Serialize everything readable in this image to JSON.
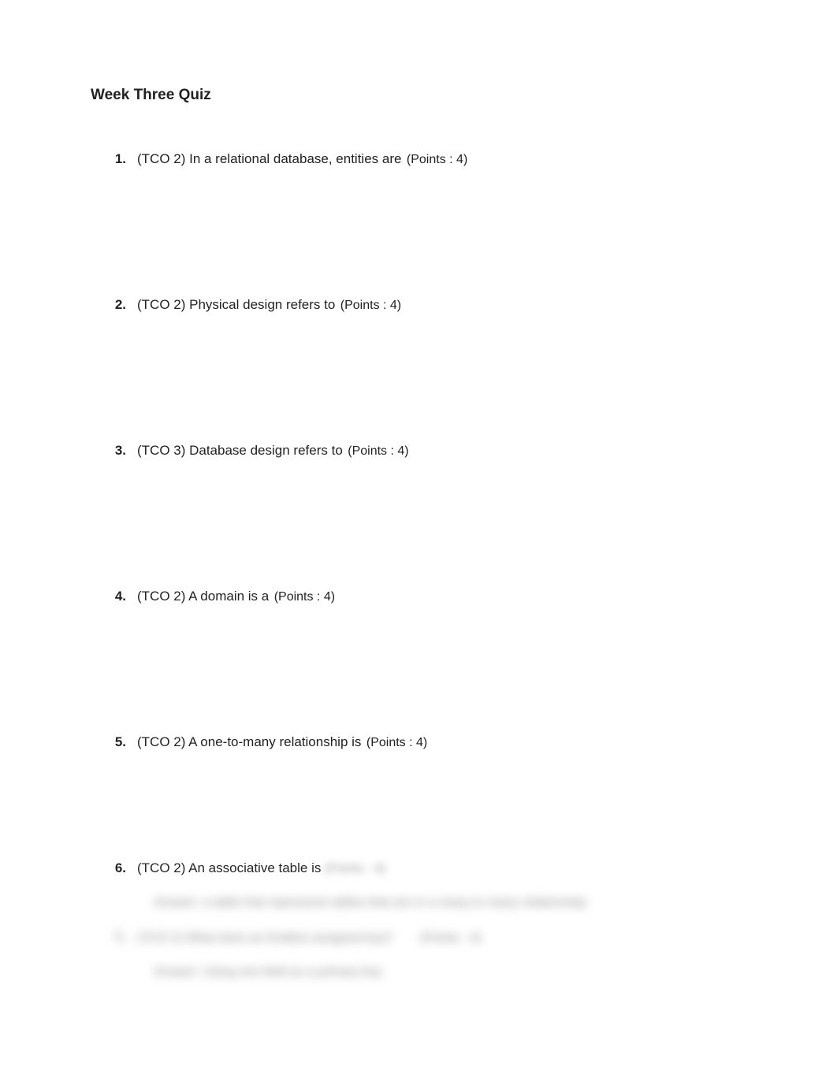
{
  "title": "Week Three Quiz",
  "questions": [
    {
      "number": "1.",
      "text": "(TCO 2) In a relational database, entities are",
      "points": "(Points : 4)"
    },
    {
      "number": "2.",
      "text": "(TCO 2) Physical design refers to",
      "points": "(Points : 4)"
    },
    {
      "number": "3.",
      "text": "(TCO 3) Database design refers to",
      "points": "(Points : 4)"
    },
    {
      "number": "4.",
      "text": "(TCO 2) A domain is a",
      "points": "(Points : 4)"
    },
    {
      "number": "5.",
      "text": "(TCO 2) A one-to-many relationship is",
      "points": "(Points : 4)"
    }
  ],
  "q6": {
    "number": "6.",
    "text": "(TCO 2) An associative table is",
    "points_blurred": "(Points : 4)"
  },
  "blurred_lines": {
    "answer6": "Answer: a table that represents tables that are in a many to many relationship",
    "q7num": "7.",
    "q7text": "(TCO 2) What does an Entities assigned key?",
    "q7points": "(Points : 4)",
    "answer7": "Answer: Using one field as a primary key"
  }
}
